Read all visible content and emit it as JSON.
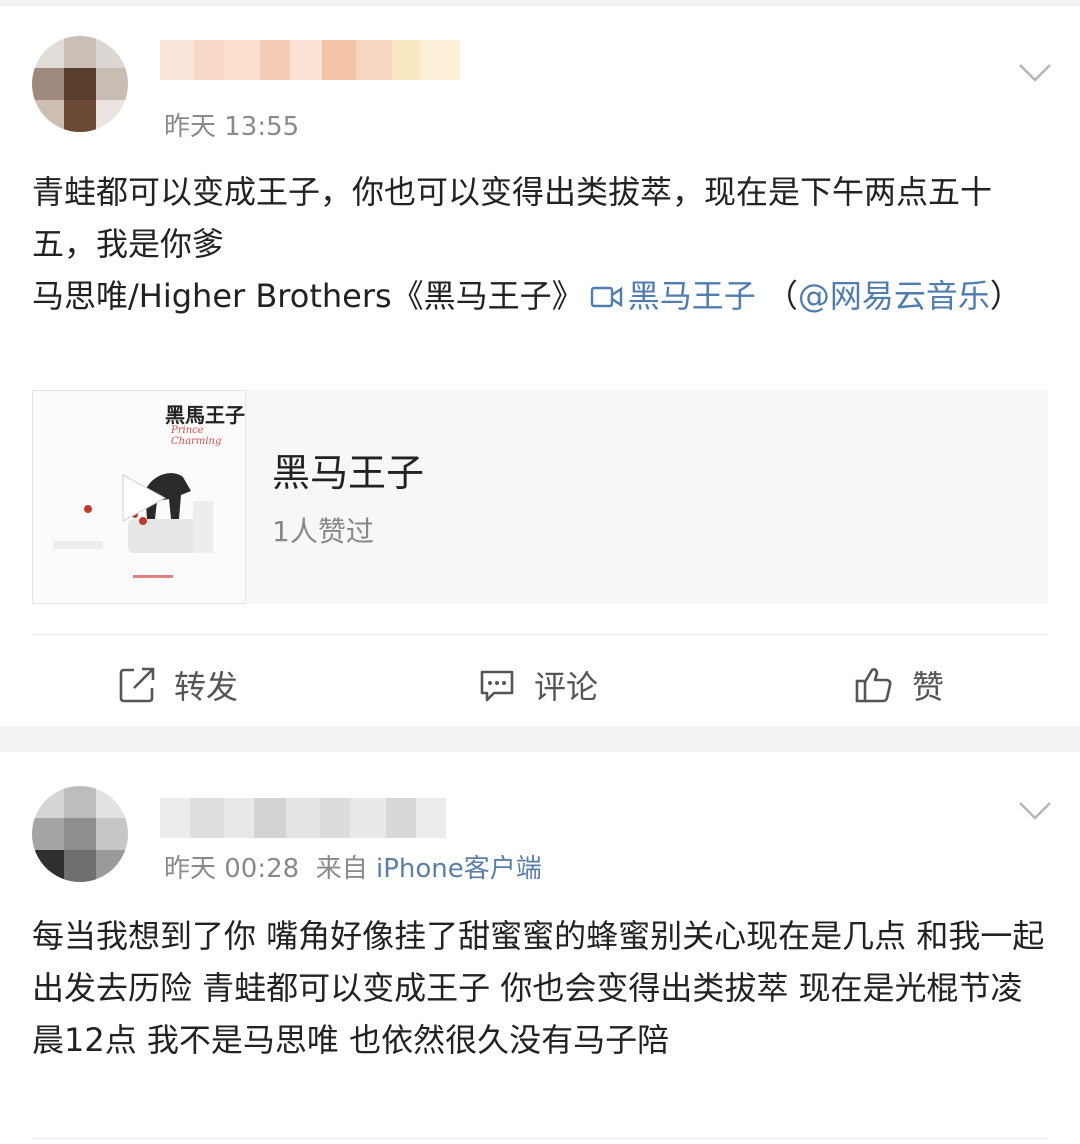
{
  "posts": [
    {
      "time": "昨天 13:55",
      "source_prefix": "",
      "source": "",
      "text_plain": "青蛙都可以变成王子，你也可以变得出类拔萃，现在是下午两点五十五，我是你爹",
      "text_song": "马思唯/Higher Brothers《黑马王子》",
      "text_link": "黑马王子",
      "text_paren_open": "（",
      "text_mention": "@网易云音乐",
      "text_paren_close": "）",
      "card": {
        "title": "黑马王子",
        "likes": "1人赞过",
        "cover_title": "黑馬王子",
        "cover_subtitle": "Prince Charming"
      },
      "actions": {
        "repost": "转发",
        "comment": "评论",
        "like": "赞"
      }
    },
    {
      "time": "昨天 00:28",
      "source_prefix": "来自",
      "source": "iPhone客户端",
      "text_plain": "每当我想到了你 嘴角好像挂了甜蜜蜜的蜂蜜别关心现在是几点 和我一起出发去历险 青蛙都可以变成王子 你也会变得出类拔萃 现在是光棍节凌晨12点 我不是马思唯 也依然很久没有马子陪"
    }
  ],
  "icons": {
    "chevron": "chevron-down-icon",
    "repost": "repost-icon",
    "comment": "comment-icon",
    "like": "thumbs-up-icon",
    "video": "video-link-icon",
    "play": "play-icon"
  },
  "colors": {
    "link": "#507daf",
    "source": "#5b7fa8",
    "meta": "#8a8a8a"
  }
}
